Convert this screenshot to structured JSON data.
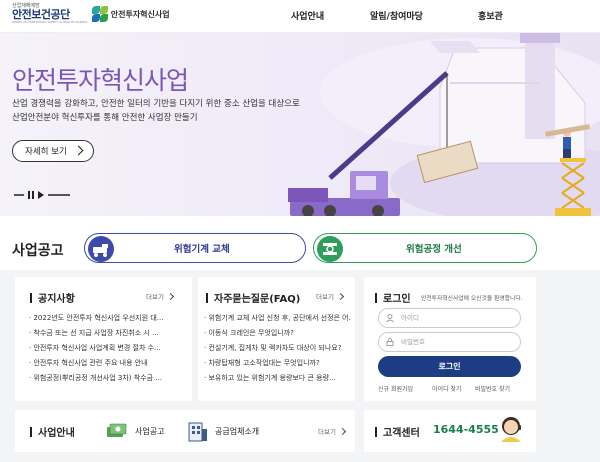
{
  "header": {
    "logo_small": "산업재해예방",
    "logo_main": "안전보건공단",
    "logo_eng": "KOREA OCCUPATIONAL SAFETY & HEALTH AGENCY",
    "logo_sub": "안전투자혁신사업",
    "nav": [
      "사업안내",
      "알림/참여마당",
      "홍보관"
    ]
  },
  "hero": {
    "title": "안전투자혁신사업",
    "desc_line1": "산업 경쟁력을 강화하고, 안전한 일터의 기반을 다지기 위한 중소 산업을 대상으로",
    "desc_line2": "산업안전분야 혁신투자를 통해 안전한 사업장 만들기",
    "more_button": "자세히 보기"
  },
  "business": {
    "title": "사업공고",
    "pill1": "위험기계 교체",
    "pill2": "위험공정 개선"
  },
  "notice": {
    "title": "공지사항",
    "more": "더보기",
    "items": [
      "2022년도 안전투자 혁신사업 우선지원 대...",
      "착수금 또는 선 지급 사업장 자진취소 시 ...",
      "안전투자 혁신사업 사업계획 변경 절차 수...",
      "안전투자 혁신사업 관련 주요 내용 안내",
      "위험공정(뿌리공정 개선사업 3차) 착수금 ..."
    ]
  },
  "faq": {
    "title": "자주묻는질문(FAQ)",
    "more": "더보기",
    "items": [
      "위험기계 교체 사업 신청 후, 공단에서 선정은 어...",
      "이동식 크레인은 무엇입니까?",
      "컨설기계, 집게차 및 렉카차도 대상이 되나요?",
      "차량탑재형 고소작업대는 무엇입니까?",
      "보유하고 있는 위험기계 용량보다 큰 용량..."
    ]
  },
  "login": {
    "title": "로그인",
    "welcome": "안전투자혁신사업에 오신것을 환영합니다.",
    "id_placeholder": "아이디",
    "pw_placeholder": "비밀번호",
    "button": "로그인",
    "links": [
      "신규 회원가입",
      "아이디 찾기",
      "비밀번호 찾기"
    ]
  },
  "guide": {
    "title": "사업안내",
    "item1": "사업공고",
    "item2": "공급업체소개",
    "more": "더보기"
  },
  "cs": {
    "title": "고객센터",
    "phone": "1644-4555"
  },
  "colors": {
    "brand_purple": "#7b56b8",
    "navy": "#1d3c84",
    "green": "#2f9e5b",
    "phone_green": "#1a7f4b"
  }
}
